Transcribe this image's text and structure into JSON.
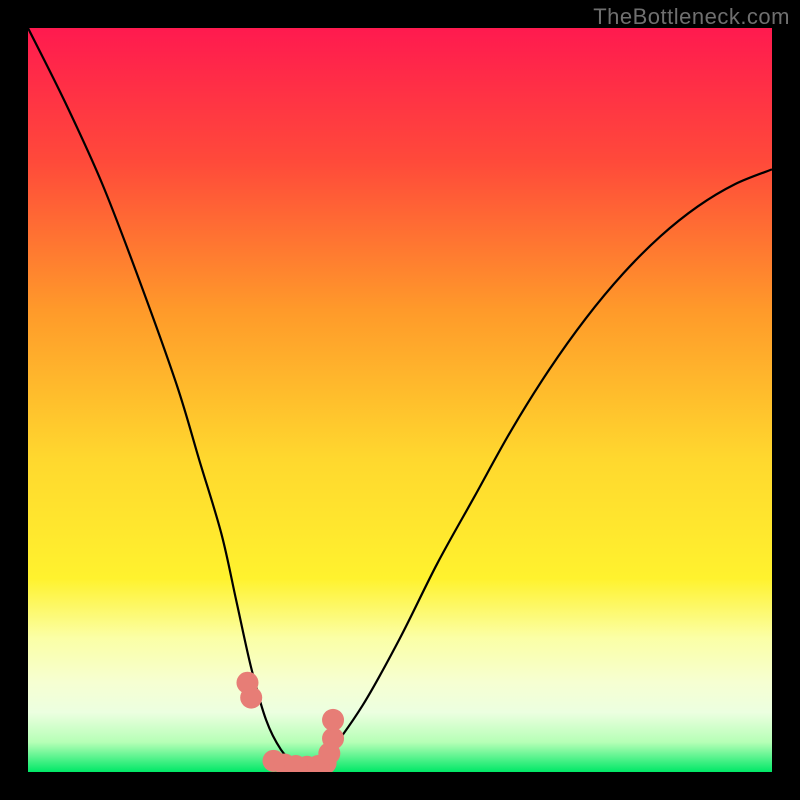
{
  "watermark": "TheBottleneck.com",
  "chart_data": {
    "type": "line",
    "title": "",
    "xlabel": "",
    "ylabel": "",
    "xlim": [
      0,
      100
    ],
    "ylim": [
      0,
      100
    ],
    "background_gradient": {
      "top": "#ff1a4f",
      "mid_upper": "#ff7a2a",
      "mid": "#ffe62e",
      "lower": "#f9ffb3",
      "band": "#e8ffe0",
      "bottom": "#00e867"
    },
    "series": [
      {
        "name": "bottleneck-curve",
        "color": "#000000",
        "x": [
          0,
          5,
          10,
          15,
          20,
          23,
          26,
          28,
          30,
          32,
          34,
          36,
          37.5,
          40,
          45,
          50,
          55,
          60,
          65,
          70,
          75,
          80,
          85,
          90,
          95,
          100
        ],
        "y": [
          100,
          90,
          79,
          66,
          52,
          42,
          32,
          23,
          14,
          7,
          3,
          1,
          0,
          2,
          9,
          18,
          28,
          37,
          46,
          54,
          61,
          67,
          72,
          76,
          79,
          81
        ]
      },
      {
        "name": "highlight-points",
        "color": "#e77d76",
        "type": "scatter",
        "x": [
          29.5,
          30.0,
          33.0,
          34.5,
          36.0,
          37.5,
          39.0,
          40.0,
          40.5,
          41.0,
          41.0
        ],
        "y": [
          12.0,
          10.0,
          1.5,
          1.0,
          0.8,
          0.7,
          0.8,
          1.2,
          2.5,
          4.5,
          7.0
        ]
      }
    ]
  }
}
